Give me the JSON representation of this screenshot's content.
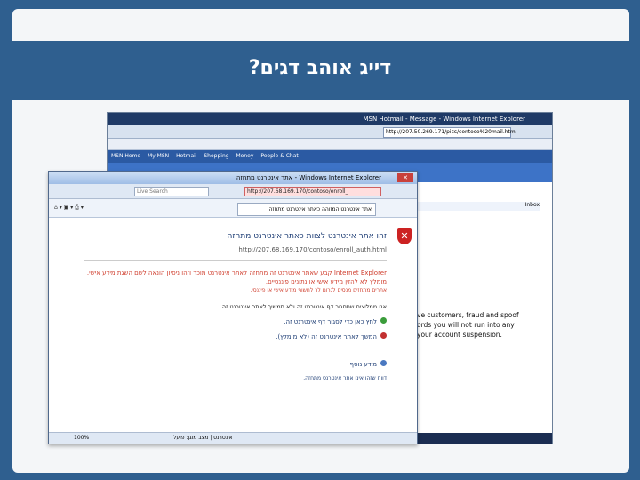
{
  "slide": {
    "title": "דייג אוהב דגים?"
  },
  "back_window": {
    "title": "MSN Hotmail - Message - Windows Internet Explorer",
    "address": "http://207.50.269.171/pics/contoso%20mail.htm",
    "nav": [
      "MSN Home",
      "My MSN",
      "Hotmail",
      "Shopping",
      "Money",
      "People & Chat"
    ],
    "inbox": "Inbox",
    "text": "ve customers, fraud and spoof\nords you will not run into any\nyour account suspension."
  },
  "front_window": {
    "title": "אתר אינטרנט מתחזה - Windows Internet Explorer",
    "address": "http://207.68.169.170/contoso/enroll_",
    "search": "Live Search",
    "tab": "אתר אינטרנט המזוהה כאתר אינטרנט מתחזה",
    "heading": "זהו אתר אינטרנט לצוות כאתר אינטרנט מתחזה",
    "url": "http://207.68.169.170/contoso/enroll_auth.html",
    "body1": "Internet Explorer קבע שאתר אינטרנט זה מתחזה לאתר אינטרנט מוכר וזהו ניסיון הונאה לשם השגת מידע אישי. מומלץ לא להזין מידע אישי או נתונים פיננסיים.",
    "body2": "אתרים מתחזים מנסים לגרום לך לחשוף מידע אישי או פיננסי.",
    "recommendation": "אנו ממליצים שתסגור דף אינטרנט זה ולא תמשיך לאתר אינטרנט זה.",
    "option_close": "לחץ כאן כדי לסגור דף אינטרנט זה.",
    "option_continue": "המשך לאתר אינטרנט זה (לא מומלץ).",
    "more_info": "מידע נוסף",
    "report": "דווח שזהו אינו אתר אינטרנט מתחזה.",
    "status_zone": "אינטרנט | מצב מוגן: פועל",
    "status_zoom": "100%"
  }
}
